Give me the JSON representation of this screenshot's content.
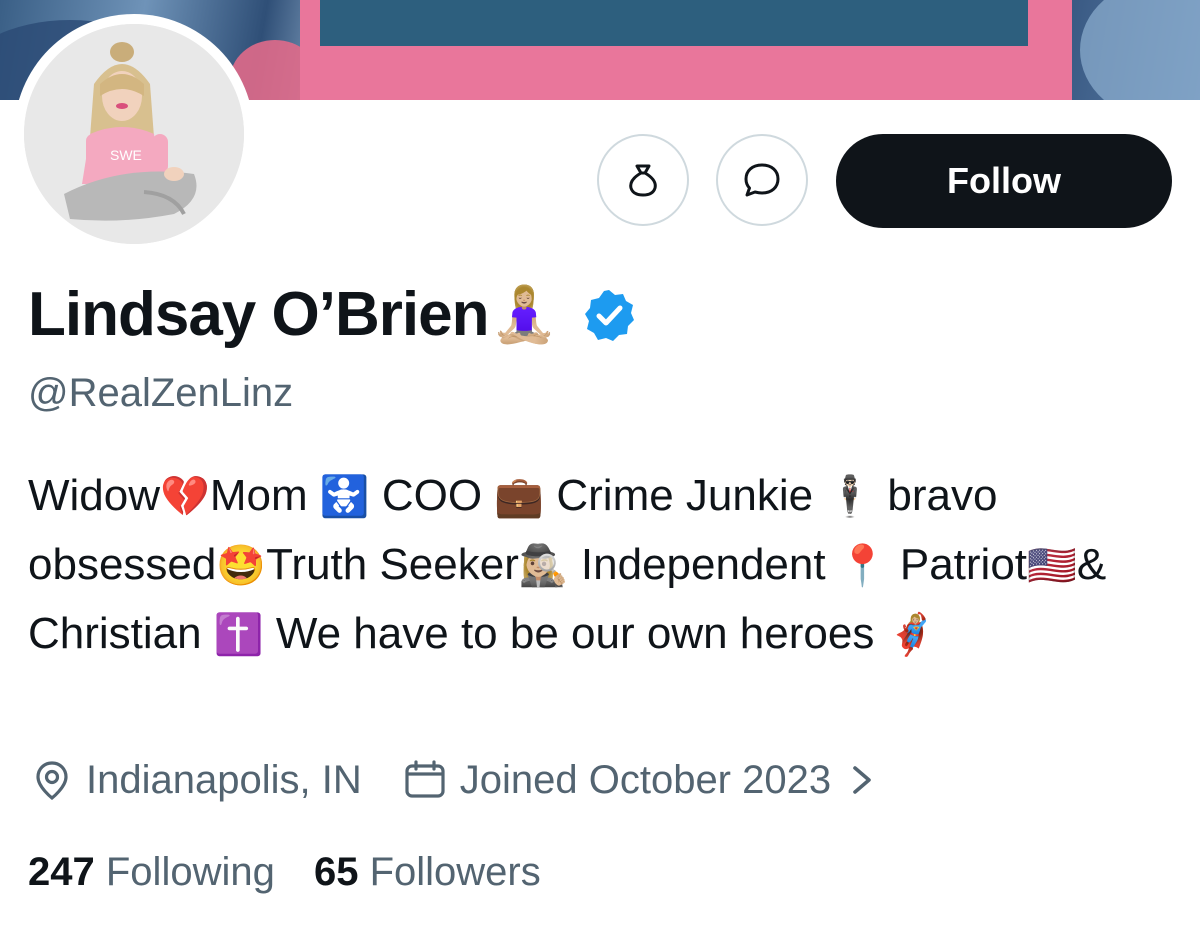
{
  "profile": {
    "display_name": "Lindsay O’Brien",
    "display_name_emoji": "🧘🏼‍♀️",
    "verified": true,
    "handle": "@RealZenLinz",
    "bio": [
      {
        "t": "Widow"
      },
      {
        "e": "💔"
      },
      {
        "t": "Mom "
      },
      {
        "e": "🚼"
      },
      {
        "t": " COO "
      },
      {
        "e": "💼"
      },
      {
        "t": " Crime Junkie "
      },
      {
        "e": "🕴🏻"
      },
      {
        "t": " bravo obsessed"
      },
      {
        "e": "🤩"
      },
      {
        "t": "Truth Seeker"
      },
      {
        "e": "🕵🏼‍♀️"
      },
      {
        "t": " Independent "
      },
      {
        "e": "📍"
      },
      {
        "t": " Patriot"
      },
      {
        "e": "🇺🇸"
      },
      {
        "t": "& Christian "
      },
      {
        "e": "✝️"
      },
      {
        "t": " We have to be our own heroes "
      },
      {
        "e": "🦸🏼‍♀️"
      }
    ],
    "location": "Indianapolis, IN",
    "joined": "Joined October 2023",
    "following_count": "247",
    "following_label": "Following",
    "followers_count": "65",
    "followers_label": "Followers"
  },
  "actions": {
    "follow_label": "Follow",
    "more_icon": "money-bag-icon",
    "message_icon": "chat-bubble-icon"
  },
  "colors": {
    "text": "#0f1419",
    "secondary": "#536471",
    "verified": "#1d9bf0",
    "follow_bg": "#0f1419",
    "banner_card_pink": "#e9769b",
    "banner_card_teal": "#2d5f7e"
  }
}
